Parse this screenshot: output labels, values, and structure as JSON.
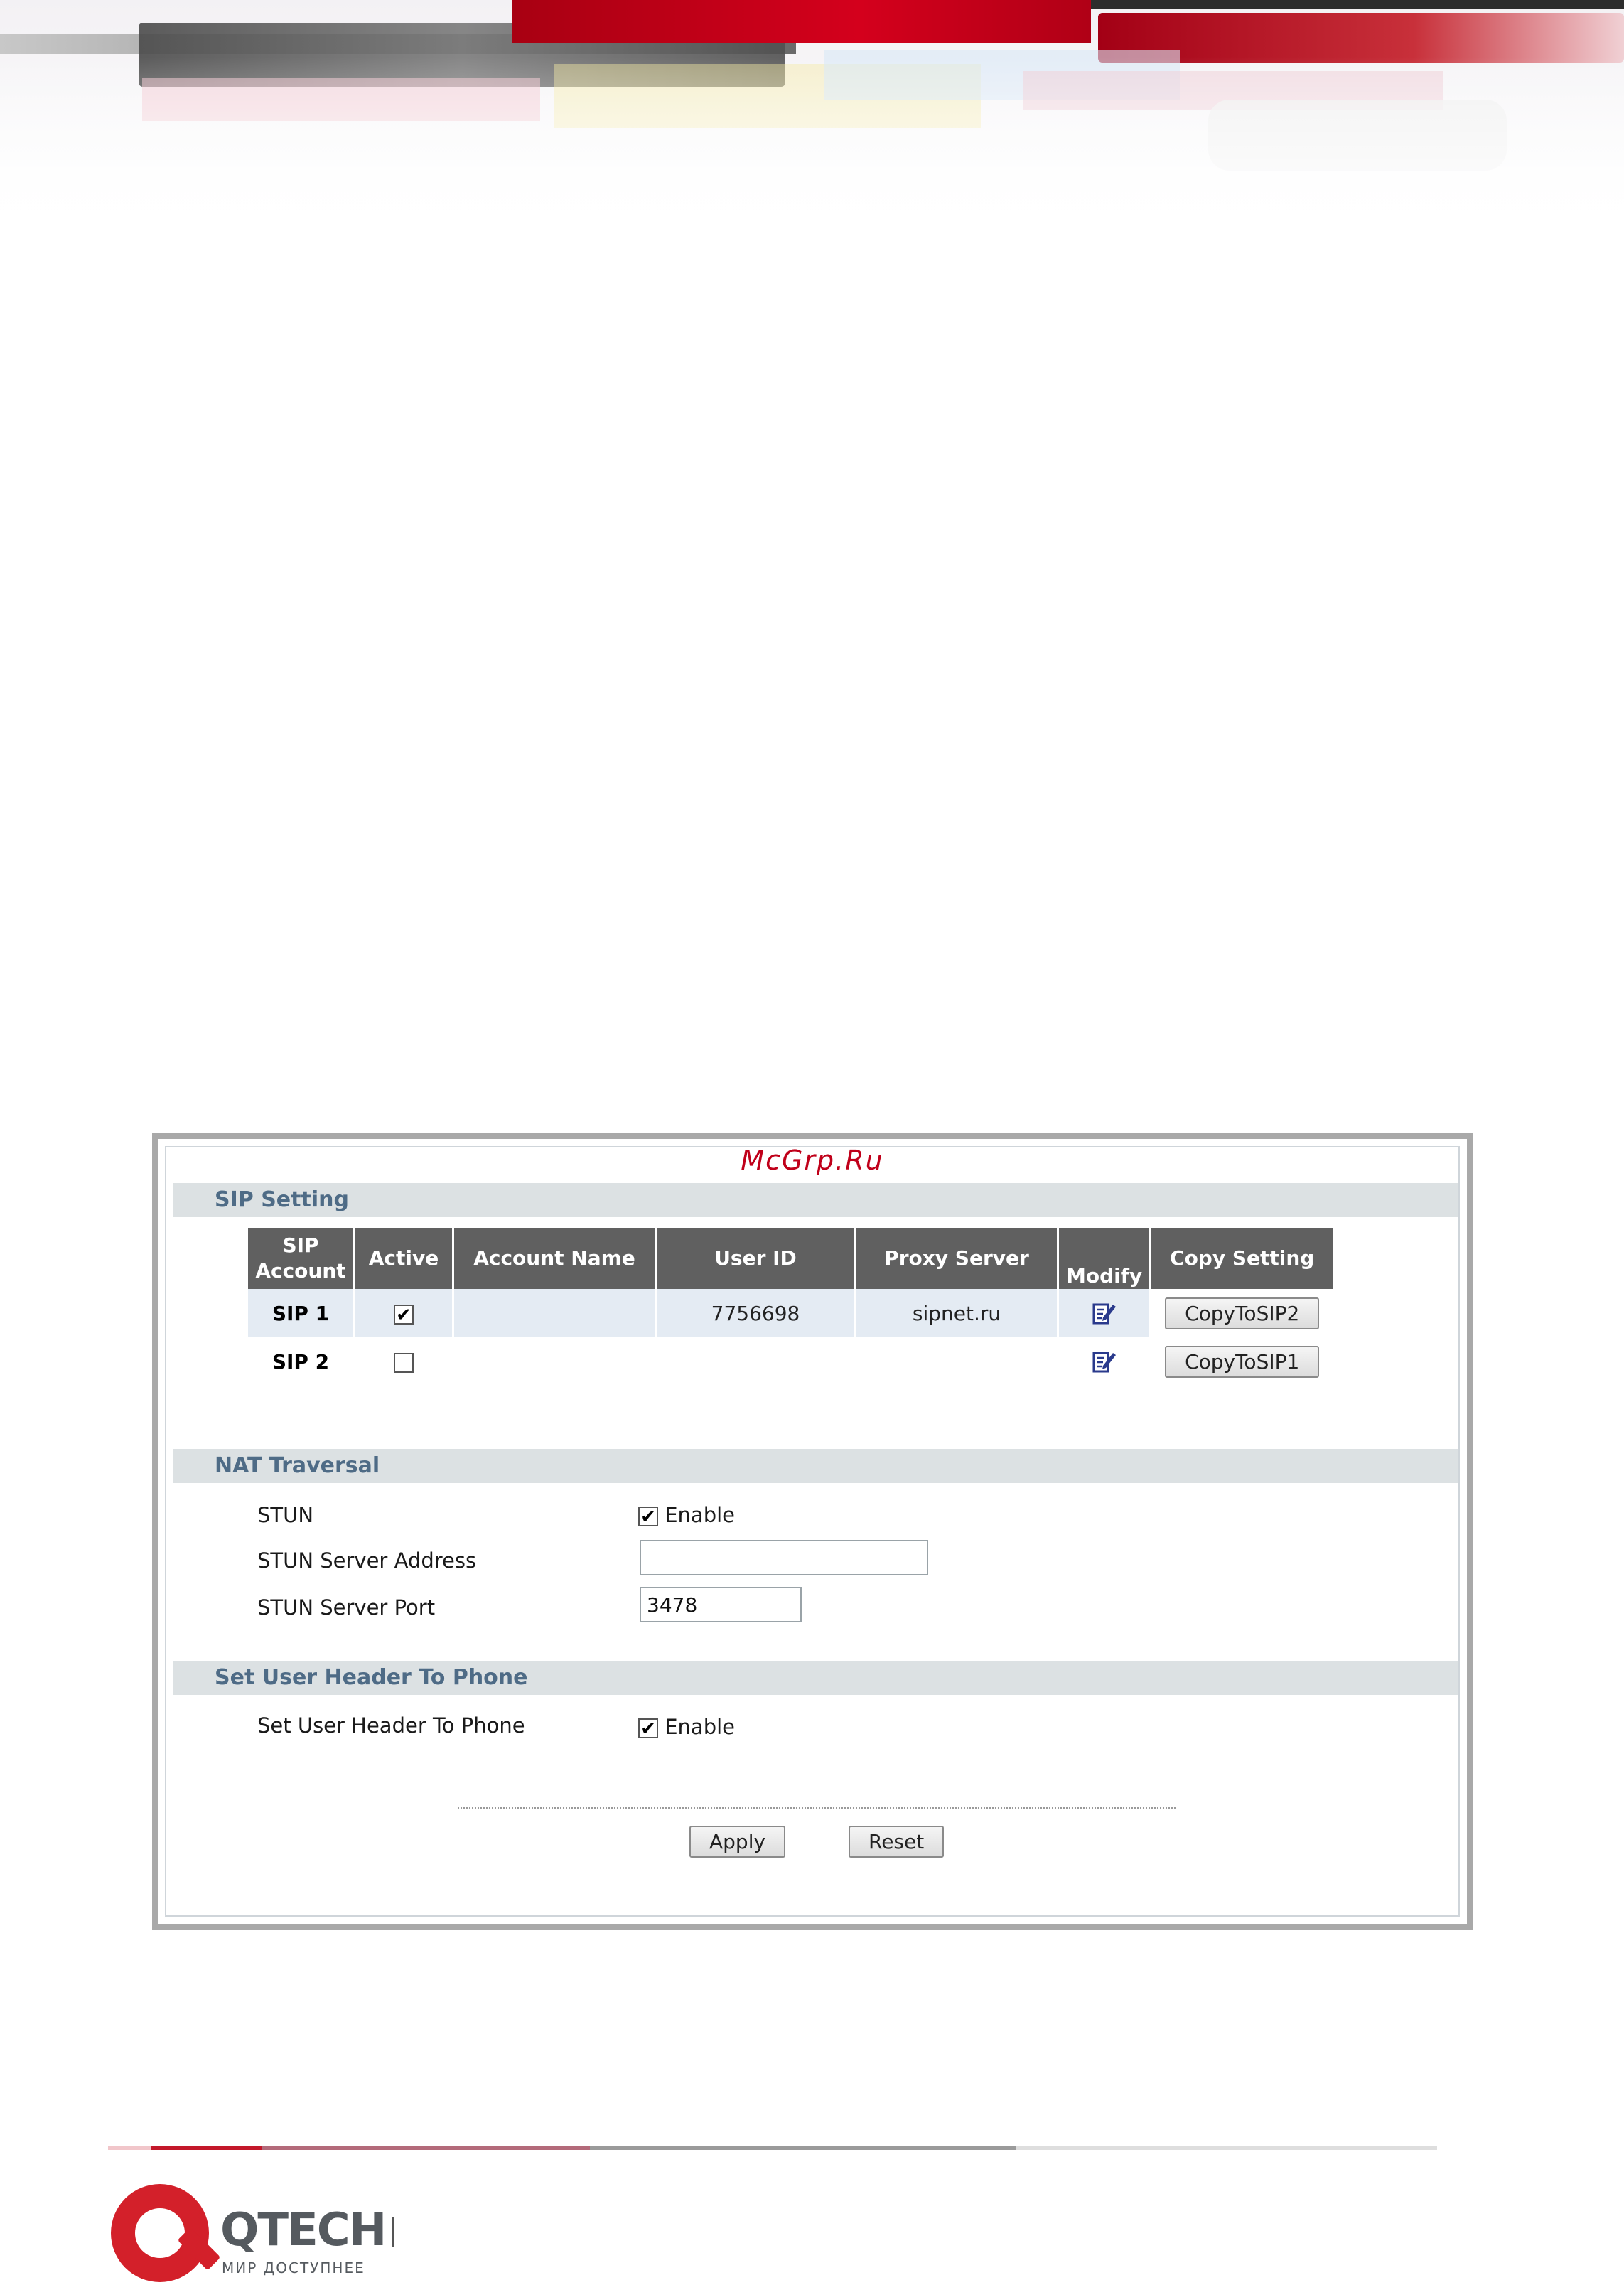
{
  "watermark": "McGrp.Ru",
  "sip_setting": {
    "title": "SIP Setting",
    "columns": [
      "SIP Account",
      "Active",
      "Account Name",
      "User ID",
      "Proxy Server",
      "Modify",
      "Copy Setting"
    ],
    "rows": [
      {
        "account": "SIP 1",
        "active": true,
        "active_mark": "✔",
        "account_name": "",
        "user_id": "7756698",
        "proxy_server": "sipnet.ru",
        "copy_label": "CopyToSIP2"
      },
      {
        "account": "SIP 2",
        "active": false,
        "active_mark": "",
        "account_name": "",
        "user_id": "",
        "proxy_server": "",
        "copy_label": "CopyToSIP1"
      }
    ]
  },
  "nat_traversal": {
    "title": "NAT Traversal",
    "stun_label": "STUN",
    "stun_enable_label": "Enable",
    "stun_enabled": true,
    "stun_enable_mark": "✔",
    "server_address_label": "STUN Server Address",
    "server_address_value": "",
    "server_port_label": "STUN Server Port",
    "server_port_value": "3478"
  },
  "user_header": {
    "title": "Set User Header To Phone",
    "label": "Set User Header To Phone",
    "enable_label": "Enable",
    "enabled": true,
    "enable_mark": "✔"
  },
  "actions": {
    "apply": "Apply",
    "reset": "Reset"
  },
  "footer": {
    "brand": "QTECH",
    "tagline": "МИР ДОСТУПНЕЕ"
  },
  "colors": {
    "brand_red": "#d3202a",
    "section_bar": "#dce1e3",
    "section_text": "#4e6b86",
    "table_header": "#606060",
    "row_highlight": "#e4ebf3"
  }
}
